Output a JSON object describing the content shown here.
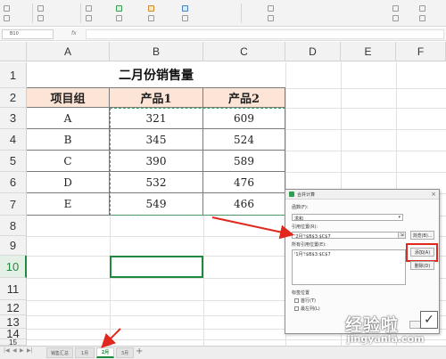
{
  "ribbon": {
    "groups": [
      {
        "name": "ribbon-group-1",
        "rows": [
          "",
          ""
        ]
      },
      {
        "name": "ribbon-group-2",
        "rows": [
          "",
          ""
        ]
      },
      {
        "name": "ribbon-group-3",
        "rows": [
          "",
          ""
        ]
      },
      {
        "name": "ribbon-group-4",
        "rows": [
          "",
          ""
        ]
      },
      {
        "name": "ribbon-group-5",
        "rows": [
          "",
          ""
        ]
      },
      {
        "name": "ribbon-group-6",
        "rows": [
          "",
          ""
        ]
      },
      {
        "name": "ribbon-group-7",
        "rows": [
          "",
          ""
        ]
      }
    ]
  },
  "formula_bar": {
    "name_box": "B10",
    "fx": "fx",
    "content": ""
  },
  "columns": [
    "A",
    "B",
    "C",
    "D",
    "E",
    "F"
  ],
  "rows": [
    "1",
    "2",
    "3",
    "4",
    "5",
    "6",
    "7",
    "8",
    "9",
    "10",
    "11",
    "12",
    "13",
    "14",
    "15"
  ],
  "active_row": "10",
  "table": {
    "title": "二月份销售量",
    "headers": [
      "项目组",
      "产品1",
      "产品2"
    ],
    "data": [
      [
        "A",
        "321",
        "609"
      ],
      [
        "B",
        "345",
        "524"
      ],
      [
        "C",
        "390",
        "589"
      ],
      [
        "D",
        "532",
        "476"
      ],
      [
        "E",
        "549",
        "466"
      ]
    ]
  },
  "sheet_tabs": {
    "nav": [
      "|◀",
      "◀",
      "▶",
      "▶|"
    ],
    "tabs": [
      {
        "label": "销售汇总",
        "active": false
      },
      {
        "label": "1月",
        "active": false
      },
      {
        "label": "2月",
        "active": true
      },
      {
        "label": "3月",
        "active": false
      }
    ],
    "add": "+"
  },
  "dialog": {
    "title": "合并计算",
    "close": "×",
    "function_label": "函数(F):",
    "function_value": "求和",
    "reference_label": "引用位置(R):",
    "reference_value": "'2月'!$B$3:$C$7",
    "browse_button": "浏览(B)...",
    "all_references_label": "所有引用位置(E):",
    "all_references": [
      "'1月'!$B$3:$C$7"
    ],
    "add_button": "添加(A)",
    "delete_button": "删除(D)",
    "label_position_title": "标签位置",
    "first_row": "首行(T)",
    "left_column": "最左列(L)"
  },
  "watermark": {
    "title": "经验啦",
    "url": "jingyanla.com",
    "check": "✓"
  },
  "colors": {
    "accent": "#1e8a3e",
    "header_fill": "#fce4d6",
    "arrow": "#e0281e",
    "dashed": "#35a85a"
  }
}
